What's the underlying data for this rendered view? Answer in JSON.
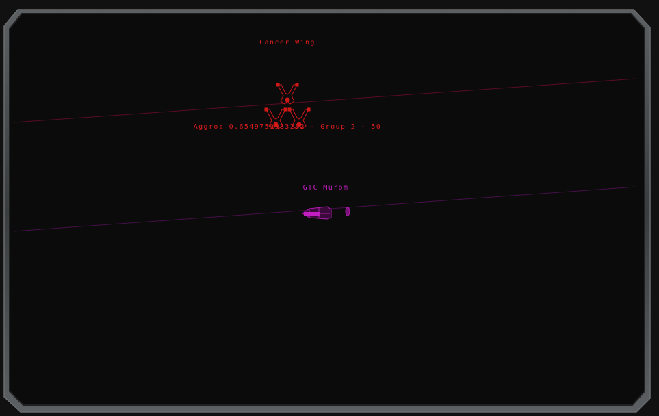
{
  "hud": {
    "enemy_group_name": "Cancer Wing",
    "enemy_status": "Aggro: 0.6549759983282 - Group 2 - 50",
    "friendly_ship_name": "GTC Murom"
  },
  "colors": {
    "background": "#0b0b0b",
    "hostile": "#e01c1c",
    "friendly": "#c21ec2",
    "frame": "#4a4d4e"
  },
  "icons": {
    "hostile_fighters": "hostile-fighter-icon",
    "friendly_ship": "capital-ship-icon"
  }
}
